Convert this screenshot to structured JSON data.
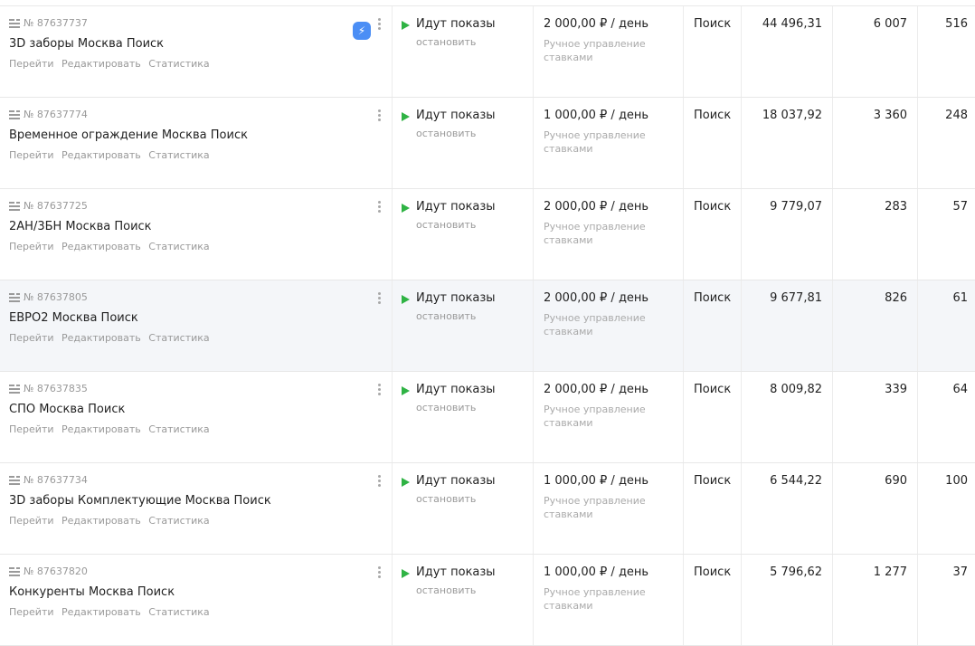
{
  "links": {
    "go": "Перейти",
    "edit": "Редактировать",
    "stats": "Статистика"
  },
  "campaigns": [
    {
      "id": "№ 87637737",
      "name": "3D заборы Москва Поиск",
      "status": "Идут показы",
      "stop": "остановить",
      "budget": "2 000,00 ₽ / день",
      "strategy": "Ручное управление ставками",
      "type": "Поиск",
      "cost": "44 496,31",
      "impressions": "6 007",
      "clicks": "516",
      "has_autopilot": true
    },
    {
      "id": "№ 87637774",
      "name": "Временное ограждение Москва Поиск",
      "status": "Идут показы",
      "stop": "остановить",
      "budget": "1 000,00 ₽ / день",
      "strategy": "Ручное управление ставками",
      "type": "Поиск",
      "cost": "18 037,92",
      "impressions": "3 360",
      "clicks": "248"
    },
    {
      "id": "№ 87637725",
      "name": "2АН/3БН Москва Поиск",
      "status": "Идут показы",
      "stop": "остановить",
      "budget": "2 000,00 ₽ / день",
      "strategy": "Ручное управление ставками",
      "type": "Поиск",
      "cost": "9 779,07",
      "impressions": "283",
      "clicks": "57"
    },
    {
      "id": "№ 87637805",
      "name": "ЕВРО2 Москва Поиск",
      "status": "Идут показы",
      "stop": "остановить",
      "budget": "2 000,00 ₽ / день",
      "strategy": "Ручное управление ставками",
      "type": "Поиск",
      "cost": "9 677,81",
      "impressions": "826",
      "clicks": "61",
      "hovered": true
    },
    {
      "id": "№ 87637835",
      "name": "СПО Москва Поиск",
      "status": "Идут показы",
      "stop": "остановить",
      "budget": "2 000,00 ₽ / день",
      "strategy": "Ручное управление ставками",
      "type": "Поиск",
      "cost": "8 009,82",
      "impressions": "339",
      "clicks": "64"
    },
    {
      "id": "№ 87637734",
      "name": "3D заборы Комплектующие Москва Поиск",
      "status": "Идут показы",
      "stop": "остановить",
      "budget": "1 000,00 ₽ / день",
      "strategy": "Ручное управление ставками",
      "type": "Поиск",
      "cost": "6 544,22",
      "impressions": "690",
      "clicks": "100"
    },
    {
      "id": "№ 87637820",
      "name": "Конкуренты Москва Поиск",
      "status": "Идут показы",
      "stop": "остановить",
      "budget": "1 000,00 ₽ / день",
      "strategy": "Ручное управление ставками",
      "type": "Поиск",
      "cost": "5 796,62",
      "impressions": "1 277",
      "clicks": "37"
    }
  ],
  "colors": {
    "play": "#2fb344",
    "autopilot": "#4b8ef5",
    "hover_row": "#f4f6f9"
  }
}
